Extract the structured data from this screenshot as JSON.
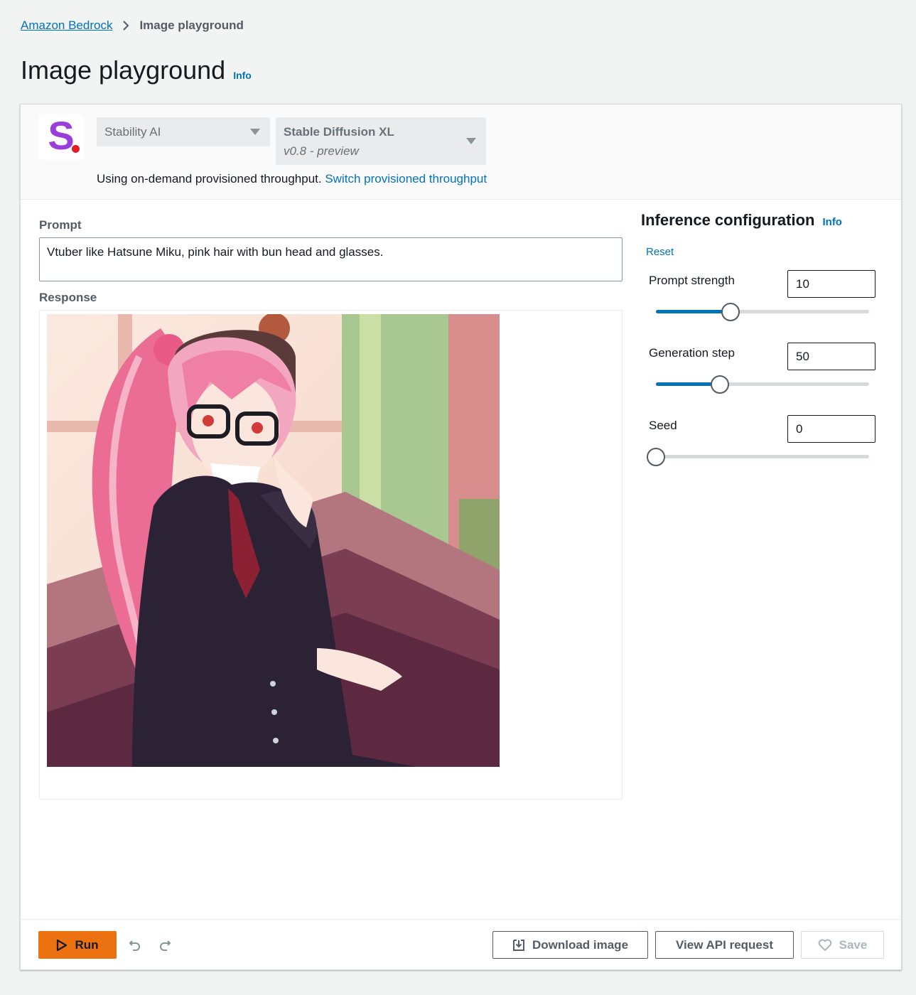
{
  "breadcrumb": {
    "root": "Amazon Bedrock",
    "current": "Image playground"
  },
  "page": {
    "title": "Image playground",
    "info": "Info"
  },
  "model": {
    "provider": "Stability AI",
    "name": "Stable Diffusion XL",
    "version": "v0.8 - preview",
    "throughput_text": "Using on-demand provisioned throughput.",
    "throughput_link": "Switch provisioned throughput"
  },
  "prompt": {
    "label": "Prompt",
    "value": "Vtuber like Hatsune Miku, pink hair with bun head and glasses."
  },
  "response": {
    "label": "Response"
  },
  "config": {
    "title": "Inference configuration",
    "info": "Info",
    "reset": "Reset",
    "params": [
      {
        "label": "Prompt strength",
        "value": "10",
        "fraction": 0.35
      },
      {
        "label": "Generation step",
        "value": "50",
        "fraction": 0.3
      },
      {
        "label": "Seed",
        "value": "0",
        "fraction": 0.0
      }
    ]
  },
  "footer": {
    "run": "Run",
    "download": "Download image",
    "view_api": "View API request",
    "save": "Save"
  },
  "colors": {
    "accent": "#0073bb",
    "run": "#ec7211",
    "logo": "#9b3ddb",
    "logo_dot": "#e31b23"
  }
}
